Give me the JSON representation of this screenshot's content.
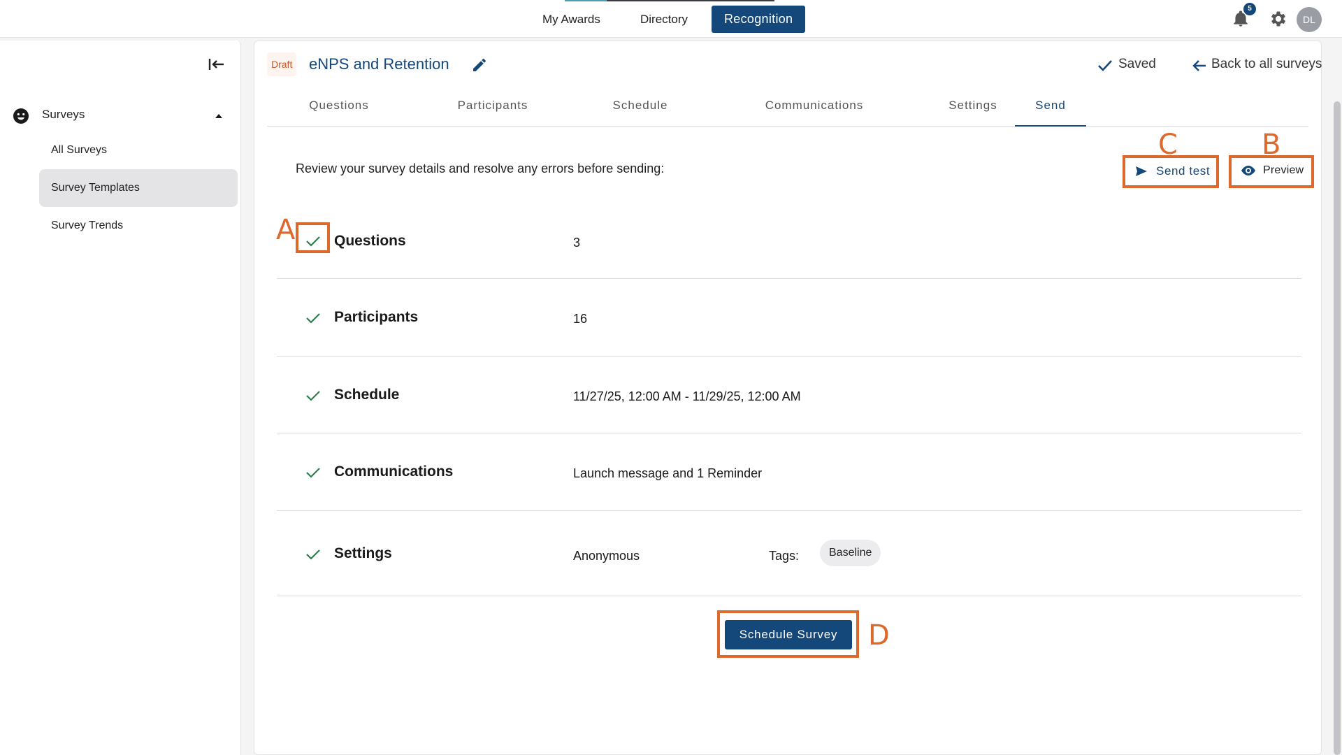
{
  "topnav": {
    "items": [
      "My Awards",
      "Directory",
      "Recognition"
    ],
    "active": "Recognition"
  },
  "notifications": {
    "count": "5"
  },
  "user": {
    "initials": "DL"
  },
  "sidebar": {
    "section_label": "Surveys",
    "items": [
      {
        "label": "All Surveys"
      },
      {
        "label": "Survey Templates"
      },
      {
        "label": "Survey Trends"
      }
    ]
  },
  "survey": {
    "status": "Draft",
    "title": "eNPS and Retention",
    "saved_label": "Saved",
    "back_label": "Back to all surveys"
  },
  "tabs": [
    "Questions",
    "Participants",
    "Schedule",
    "Communications",
    "Settings",
    "Send"
  ],
  "active_tab": "Send",
  "send": {
    "instructions": "Review your survey details and resolve any errors before sending:",
    "send_test_label": "Send test",
    "preview_label": "Preview",
    "rows": [
      {
        "label": "Questions",
        "value": "3"
      },
      {
        "label": "Participants",
        "value": "16"
      },
      {
        "label": "Schedule",
        "value": "11/27/25, 12:00 AM - 11/29/25, 12:00 AM"
      },
      {
        "label": "Communications",
        "value": "Launch message and 1 Reminder"
      },
      {
        "label": "Settings",
        "value": "Anonymous",
        "tags_label": "Tags:",
        "tag": "Baseline"
      }
    ],
    "primary_label": "Schedule Survey"
  },
  "annotations": {
    "a": "A",
    "b": "B",
    "c": "C",
    "d": "D"
  },
  "colors": {
    "brand": "#14477a",
    "annotation": "#dd6a2c",
    "check": "#2e7d4f",
    "draft": "#c9582a"
  }
}
